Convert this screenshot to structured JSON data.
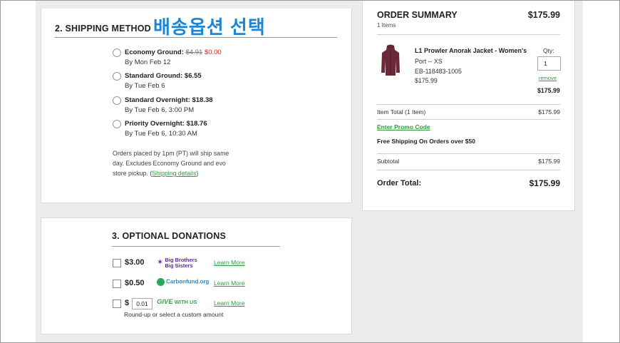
{
  "shipping": {
    "title": "2. SHIPPING METHOD",
    "overlay_korean": "배송옵션 선택",
    "options": [
      {
        "name": "Economy Ground:",
        "old_price": "$4.91",
        "new_price": "$0.00",
        "date": "By Mon Feb 12"
      },
      {
        "name": "Standard Ground: $6.55",
        "date": "By Tue Feb 6"
      },
      {
        "name": "Standard Overnight: $18.38",
        "date": "By Tue Feb 6, 3:00 PM"
      },
      {
        "name": "Priority Overnight: $18.76",
        "date": "By Tue Feb 6, 10:30 AM"
      }
    ],
    "note_line1": "Orders placed by 1pm (PT) will ship same",
    "note_line2": "day. Excludes Economy Ground and evo",
    "note_line3": "store pickup. (",
    "note_link": "Shipping details",
    "note_close": ")"
  },
  "donations": {
    "title": "3. OPTIONAL DONATIONS",
    "rows": [
      {
        "amount": "$3.00",
        "org_line1": "Big Brothers",
        "org_line2": "Big Sisters",
        "learn": "Learn More"
      },
      {
        "amount": "$0.50",
        "org": "Carbonfund.org",
        "learn": "Learn More"
      },
      {
        "amount": "$",
        "input_value": "0.01",
        "org_give": "GIVE",
        "org_withus": "WITH US",
        "learn": "Learn More"
      }
    ],
    "roundup": "Round-up or select a custom amount"
  },
  "summary": {
    "title": "ORDER SUMMARY",
    "total_top": "$175.99",
    "items_count": "1 Items",
    "product_name": "L1 Prowler Anorak Jacket - Women's",
    "product_variant": "Port -- XS",
    "product_sku": "EB-118483-1005",
    "product_price": "$175.99",
    "qty_label": "Qty:",
    "qty_value": "1",
    "remove": "remove",
    "line_total": "$175.99",
    "item_total_label": "Item Total (1 Item)",
    "item_total_value": "$175.99",
    "promo": "Enter Promo Code",
    "free_shipping": "Free Shipping On Orders over $50",
    "subtotal_label": "Subtotal",
    "subtotal_value": "$175.99",
    "order_total_label": "Order Total:",
    "order_total_value": "$175.99"
  },
  "colors": {
    "accent_green": "#2e9a3e",
    "korean_blue": "#1a86d6",
    "sale_red": "#dd2222",
    "jacket": "#6b2a3a"
  }
}
